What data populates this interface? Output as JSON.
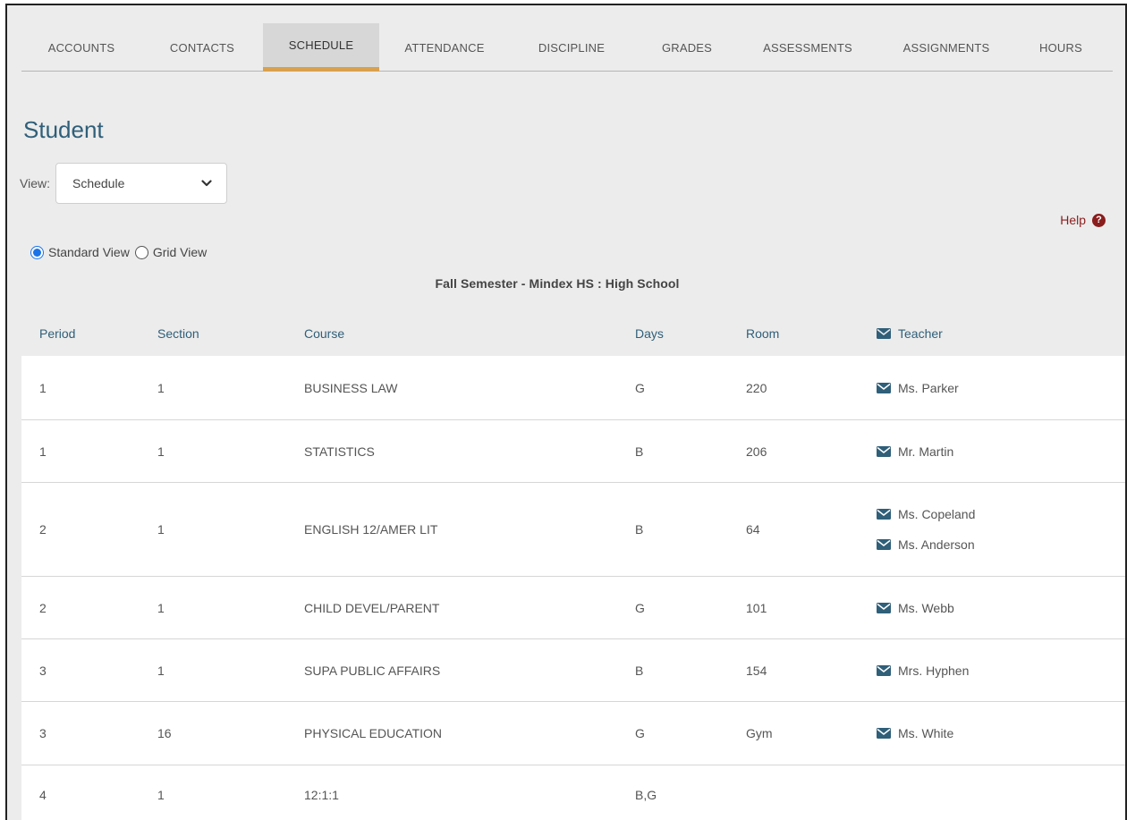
{
  "tabs": [
    {
      "label": "ACCOUNTS",
      "active": false
    },
    {
      "label": "CONTACTS",
      "active": false
    },
    {
      "label": "SCHEDULE",
      "active": true
    },
    {
      "label": "ATTENDANCE",
      "active": false
    },
    {
      "label": "DISCIPLINE",
      "active": false
    },
    {
      "label": "GRADES",
      "active": false
    },
    {
      "label": "ASSESSMENTS",
      "active": false
    },
    {
      "label": "ASSIGNMENTS",
      "active": false
    },
    {
      "label": "HOURS",
      "active": false
    }
  ],
  "page_title": "Student",
  "view": {
    "label": "View:",
    "selected": "Schedule"
  },
  "help": {
    "label": "Help",
    "icon": "question-circle-icon"
  },
  "view_mode": {
    "standard": "Standard View",
    "grid": "Grid View",
    "selected": "standard"
  },
  "term": "Fall Semester - Mindex HS : High School",
  "table": {
    "headers": {
      "period": "Period",
      "section": "Section",
      "course": "Course",
      "days": "Days",
      "room": "Room",
      "teacher": "Teacher"
    },
    "rows": [
      {
        "period": "1",
        "section": "1",
        "course": "BUSINESS LAW",
        "days": "G",
        "room": "220",
        "teachers": [
          "Ms. Parker"
        ]
      },
      {
        "period": "1",
        "section": "1",
        "course": "STATISTICS",
        "days": "B",
        "room": "206",
        "teachers": [
          "Mr. Martin"
        ]
      },
      {
        "period": "2",
        "section": "1",
        "course": "ENGLISH 12/AMER LIT",
        "days": "B",
        "room": "64",
        "teachers": [
          "Ms. Copeland",
          "Ms. Anderson"
        ]
      },
      {
        "period": "2",
        "section": "1",
        "course": "CHILD DEVEL/PARENT",
        "days": "G",
        "room": "101",
        "teachers": [
          "Ms. Webb"
        ]
      },
      {
        "period": "3",
        "section": "1",
        "course": "SUPA PUBLIC AFFAIRS",
        "days": "B",
        "room": "154",
        "teachers": [
          "Mrs. Hyphen"
        ]
      },
      {
        "period": "3",
        "section": "16",
        "course": "PHYSICAL EDUCATION",
        "days": "G",
        "room": "Gym",
        "teachers": [
          "Ms. White"
        ]
      },
      {
        "period": "4",
        "section": "1",
        "course": "12:1:1",
        "days": "B,G",
        "room": "",
        "teachers": []
      }
    ]
  },
  "colors": {
    "accent": "#d9a04e",
    "heading": "#2f5f79",
    "help": "#8a1d1d",
    "radio": "#1a73e8"
  }
}
